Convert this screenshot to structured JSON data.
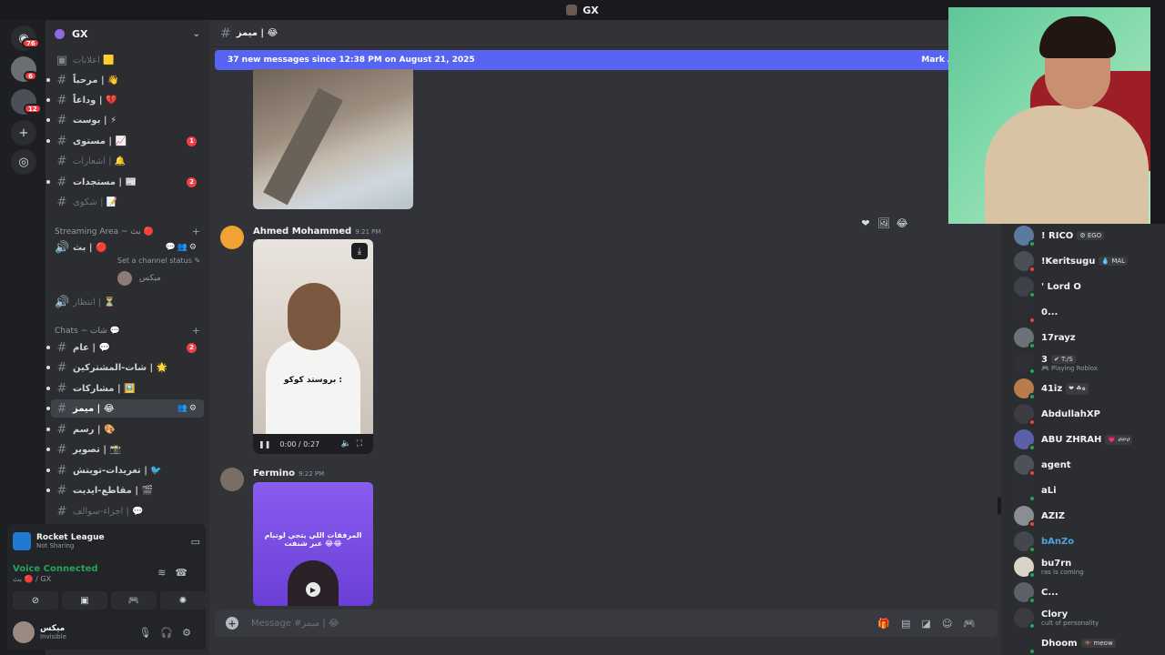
{
  "window": {
    "title": "GX"
  },
  "rail": {
    "home_badge": "76",
    "server_badges": [
      "6",
      "12"
    ]
  },
  "server": {
    "name": "GX"
  },
  "channels": [
    {
      "label": "اعلانات 🟨",
      "type": "text",
      "muted": true
    },
    {
      "label": "مرحباً | 👋",
      "type": "text",
      "bullet": true
    },
    {
      "label": "وداعاً | 💔",
      "type": "text",
      "bullet": true
    },
    {
      "label": "بوست | ⚡",
      "type": "text",
      "bullet": true
    },
    {
      "label": "مستوى | 📈",
      "type": "text",
      "bullet": true,
      "badge": "1"
    },
    {
      "label": "اشعارات | 🔔",
      "type": "text",
      "muted": true
    },
    {
      "label": "مستجدات | 📰",
      "type": "text",
      "bullet": true,
      "badge": "2"
    },
    {
      "label": "شكوى | 📝",
      "type": "text",
      "muted": true
    }
  ],
  "categories": {
    "streaming": "Streaming Area ~ بث 🔴",
    "chats": "Chats ~ شات 💬"
  },
  "voice_channels": [
    {
      "label": "بث | 🔴",
      "status": "Set a channel status ✎",
      "user": "ميكس"
    },
    {
      "label": "انتظار | ⏳"
    }
  ],
  "chat_channels": [
    {
      "label": "عام | 💬",
      "badge": "2"
    },
    {
      "label": "شات-المشتركين | 🌟"
    },
    {
      "label": "مشاركات | 🖼️"
    },
    {
      "label": "ميمز | 😂",
      "active": true
    },
    {
      "label": "رسم | 🎨"
    },
    {
      "label": "تصوير | 📸"
    },
    {
      "label": "تغريدات-تويتش | 🐦"
    },
    {
      "label": "مقاطع-ايديت | 🎬"
    },
    {
      "label": "اجزاء-سوالف | 💬",
      "muted": true
    }
  ],
  "activity": {
    "game": "Rocket League",
    "status": "Not Sharing"
  },
  "voice": {
    "status": "Voice Connected",
    "channel": "بث 🔴 / GX"
  },
  "user": {
    "name": "ميكس",
    "status": "Invisible"
  },
  "main": {
    "channel_title": "ميمز | 😂",
    "new_messages": "37 new messages since 12:38 PM on August 21, 2025",
    "mark_as_read": "Mark As Read",
    "composer_placeholder": "Message #ميمز | 😂"
  },
  "messages": [
    {
      "author": "Ahmed Mohammed",
      "time": "9:21 PM",
      "video_caption": "بروستد كوكو :",
      "video_time": "0:00 / 0:27",
      "reactions": [
        "❤",
        "🖼",
        "😂"
      ]
    },
    {
      "author": "Fermino",
      "time": "9:22 PM",
      "video_caption": "المرفقات اللي يتجي لوتبام عبر شنفت 😂😂"
    }
  ],
  "members": [
    {
      "name": "! RICO",
      "tag": "⚙ EGO",
      "color": "#5a7a9e",
      "dot": "#23a55a"
    },
    {
      "name": "!Keritsugu",
      "tag": "💧 MAL",
      "color": "#4a4e55",
      "dot": "#f23f43"
    },
    {
      "name": "' Lord O",
      "color": "#3e4147",
      "dot": "#23a55a"
    },
    {
      "name": "0...",
      "color": "#2c2e33",
      "dot": "#f23f43"
    },
    {
      "name": "17rayz",
      "color": "#6d7178",
      "dot": "#23a55a"
    },
    {
      "name": "3",
      "tag": "✔ T:/S",
      "sub": "🎮 Playing Roblox",
      "color": "#2f3136",
      "dot": "#23a55a"
    },
    {
      "name": "41iz",
      "tag": "❤ ☘๑",
      "color": "#b97a4e",
      "dot": "#23a55a"
    },
    {
      "name": "AbdullahXP",
      "color": "#3b3d42",
      "dot": "#f23f43"
    },
    {
      "name": "ABU ZHRAH",
      "tag": "💗 ሀሠሀ",
      "color": "#5a5fa8",
      "dot": "#23a55a"
    },
    {
      "name": "agent",
      "color": "#4e5258",
      "dot": "#f23f43"
    },
    {
      "name": "aLi",
      "color": "#2c2e33",
      "dot": "#23a55a"
    },
    {
      "name": "AZIZ",
      "color": "#8a8d93",
      "dot": "#f23f43"
    },
    {
      "name": "bAnZo",
      "color": "#44484e",
      "dot": "#23a55a",
      "name_color": "#4fa3e0"
    },
    {
      "name": "bu7rn",
      "sub": "ras is coming",
      "color": "#d9d3c8",
      "dot": "#23a55a"
    },
    {
      "name": "C...",
      "color": "#5c6067",
      "dot": "#23a55a"
    },
    {
      "name": "Clory",
      "sub": "cult of personality",
      "color": "#3a3c41",
      "dot": "#23a55a"
    },
    {
      "name": "Dhoom",
      "tag": "🦇 meow",
      "color": "#2a2c31",
      "dot": "#23a55a"
    }
  ],
  "colors": {
    "accent": "#5865f2",
    "online": "#23a55a",
    "dnd": "#f23f43"
  }
}
